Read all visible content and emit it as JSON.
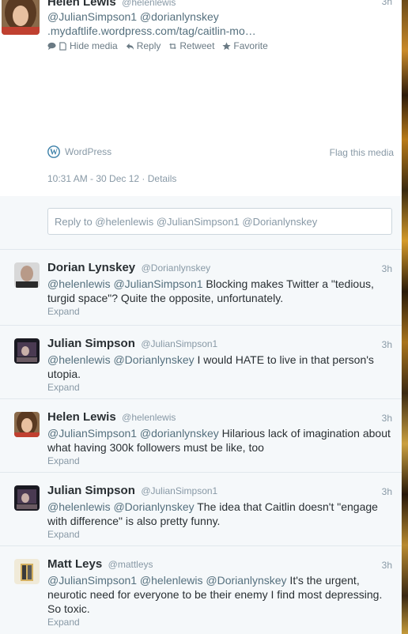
{
  "header_tweet": {
    "name": "Helen Lewis",
    "handle": "@helenlewis",
    "time": "3h",
    "mentions": "@JulianSimpson1 @dorianlynskey",
    "link": ".mydaftlife.wordpress.com/tag/caitlin-mo…",
    "actions": {
      "hide_media": "Hide media",
      "reply": "Reply",
      "retweet": "Retweet",
      "favorite": "Favorite"
    },
    "media_source": "WordPress",
    "flag_media": "Flag this media",
    "timestamp": "10:31 AM - 30 Dec 12",
    "details": "Details"
  },
  "reply": {
    "placeholder": "Reply to @helenlewis @JulianSimpson1 @Dorianlynskey"
  },
  "tweets": [
    {
      "name": "Dorian Lynskey",
      "handle": "@Dorianlynskey",
      "time": "3h",
      "mentions": "@helenlewis @JulianSimpson1",
      "text": " Blocking makes Twitter a \"tedious, turgid space\"? Quite the opposite, unfortunately.",
      "expand": "Expand"
    },
    {
      "name": "Julian Simpson",
      "handle": "@JulianSimpson1",
      "time": "3h",
      "mentions": "@helenlewis @Dorianlynskey",
      "text": " I would HATE to live in that person's utopia.",
      "expand": "Expand"
    },
    {
      "name": "Helen Lewis",
      "handle": "@helenlewis",
      "time": "3h",
      "mentions": "@JulianSimpson1 @dorianlynskey",
      "text": " Hilarious lack of imagination about what having 300k followers must be like, too",
      "expand": "Expand"
    },
    {
      "name": "Julian Simpson",
      "handle": "@JulianSimpson1",
      "time": "3h",
      "mentions": "@helenlewis @Dorianlynskey",
      "text": " The idea that Caitlin doesn't \"engage with difference\" is also pretty funny.",
      "expand": "Expand"
    },
    {
      "name": "Matt Leys",
      "handle": "@mattleys",
      "time": "3h",
      "mentions": "@JulianSimpson1 @helenlewis @Dorianlynskey",
      "text": " It's the urgent, neurotic need for everyone to be their enemy I find most depressing. So toxic.",
      "expand": "Expand"
    }
  ]
}
